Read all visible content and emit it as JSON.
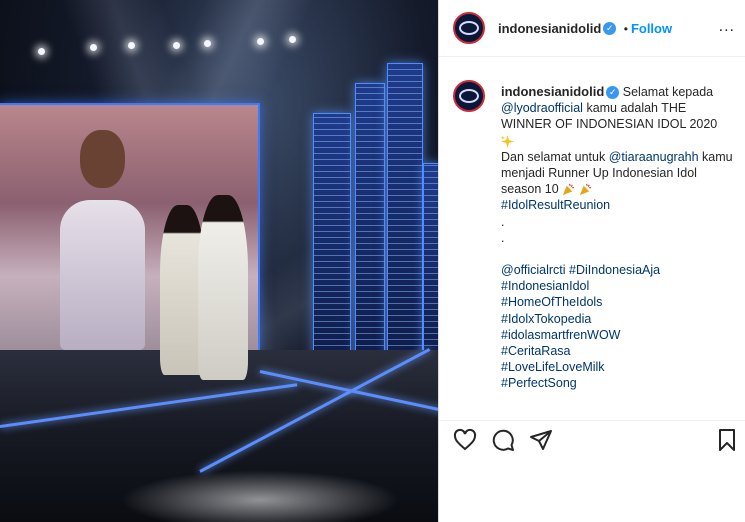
{
  "account": {
    "username": "indonesianidolid",
    "follow_label": "Follow",
    "separator": "•",
    "more_label": "..."
  },
  "caption": {
    "username": "indonesianidolid",
    "line1_text": "Selamat kepada",
    "line2_mention": "@lyodraofficial",
    "line2_text": "kamu adalah THE WINNER OF INDONESIAN IDOL 2020",
    "line3_text": "Dan selamat untuk",
    "line3_mention": "@tiaraanugrahh",
    "line3_rest": "kamu menjadi Runner Up Indonesian Idol season 10",
    "tag_result": "#IdolResultReunion",
    "dot1": ".",
    "dot2": ".",
    "mention_rcti": "@officialrcti",
    "tag_diindonesia": "#DiIndonesiaAja",
    "tags": [
      "#IndonesianIdol",
      "#HomeOfTheIdols",
      "#IdolxTokopedia",
      "#idolasmartfrenWOW",
      "#CeritaRasa",
      "#LoveLifeLoveMilk",
      "#PerfectSong"
    ]
  },
  "icons": {
    "like": "heart-icon",
    "comment": "comment-icon",
    "share": "paper-plane-icon",
    "save": "bookmark-icon"
  },
  "colors": {
    "link": "#00376b",
    "follow": "#0095f6",
    "verified": "#3897f0",
    "stage_blue": "#3c7bff"
  }
}
